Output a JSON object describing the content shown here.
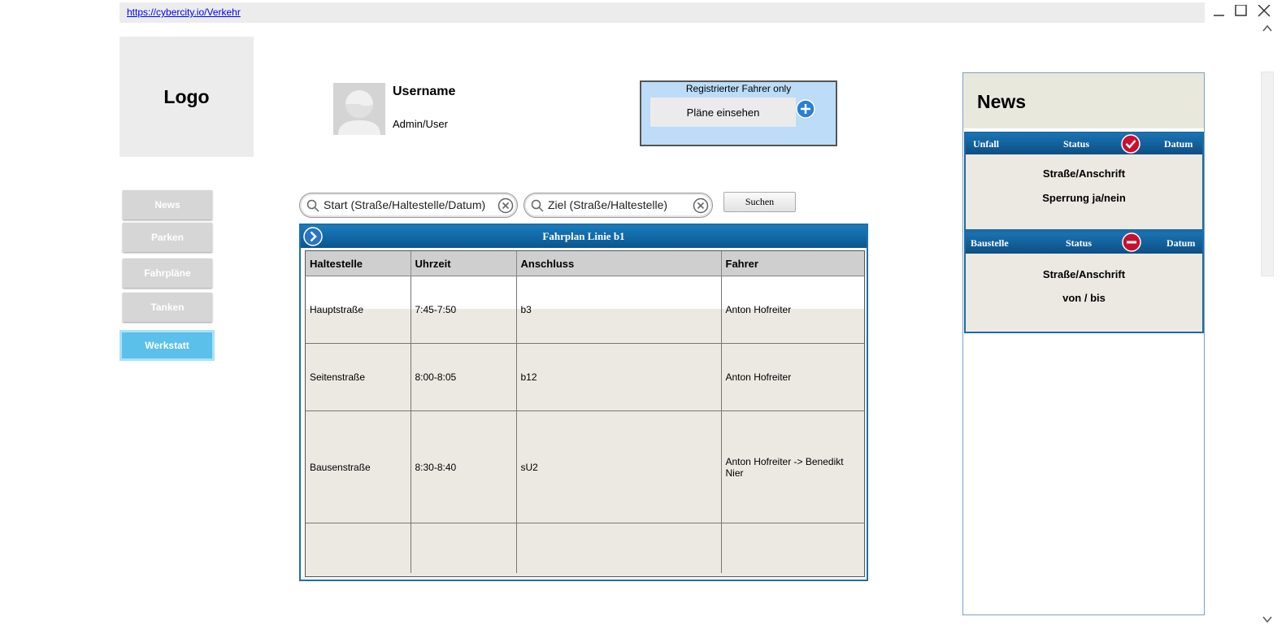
{
  "browser": {
    "url": "https://cybercity.io/Verkehr"
  },
  "logo": {
    "text": "Logo"
  },
  "user": {
    "name": "Username",
    "role": "Admin/User"
  },
  "registered": {
    "title": "Registrierter Fahrer only",
    "button_label": "Pläne einsehen"
  },
  "nav": {
    "items": [
      {
        "label": "News"
      },
      {
        "label": "Parken"
      },
      {
        "label": "Fahrpläne"
      },
      {
        "label": "Tanken"
      },
      {
        "label": "Werkstatt",
        "active": true
      }
    ]
  },
  "search": {
    "start_placeholder": "Start (Straße/Haltestelle/Datum)",
    "ziel_placeholder": "Ziel (Straße/Haltestelle)",
    "button_label": "Suchen"
  },
  "schedule": {
    "title": "Fahrplan Linie b1",
    "columns": [
      "Haltestelle",
      "Uhrzeit",
      "Anschluss",
      "Fahrer"
    ],
    "rows": [
      [
        "Hauptstraße",
        "7:45-7:50",
        "b3",
        "Anton Hofreiter"
      ],
      [
        "Seitenstraße",
        "8:00-8:05",
        "b12",
        "Anton Hofreiter"
      ],
      [
        "Bausenstraße",
        "8:30-8:40",
        "sU2",
        "Anton Hofreiter -> Benedikt Nier"
      ],
      [
        "",
        "",
        "",
        ""
      ]
    ]
  },
  "news": {
    "title": "News",
    "cards": [
      {
        "type": "Unfall",
        "status_label": "Status",
        "date_label": "Datum",
        "status_icon": "check-icon",
        "line1": "Straße/Anschrift",
        "line2": "Sperrung ja/nein"
      },
      {
        "type": "Baustelle",
        "status_label": "Status",
        "date_label": "Datum",
        "status_icon": "minus-icon",
        "line1": "Straße/Anschrift",
        "line2": "von / bis"
      }
    ]
  },
  "colors": {
    "accent": "#1a6fae",
    "active_nav": "#5bc0ea",
    "status_red": "#c8102e"
  }
}
